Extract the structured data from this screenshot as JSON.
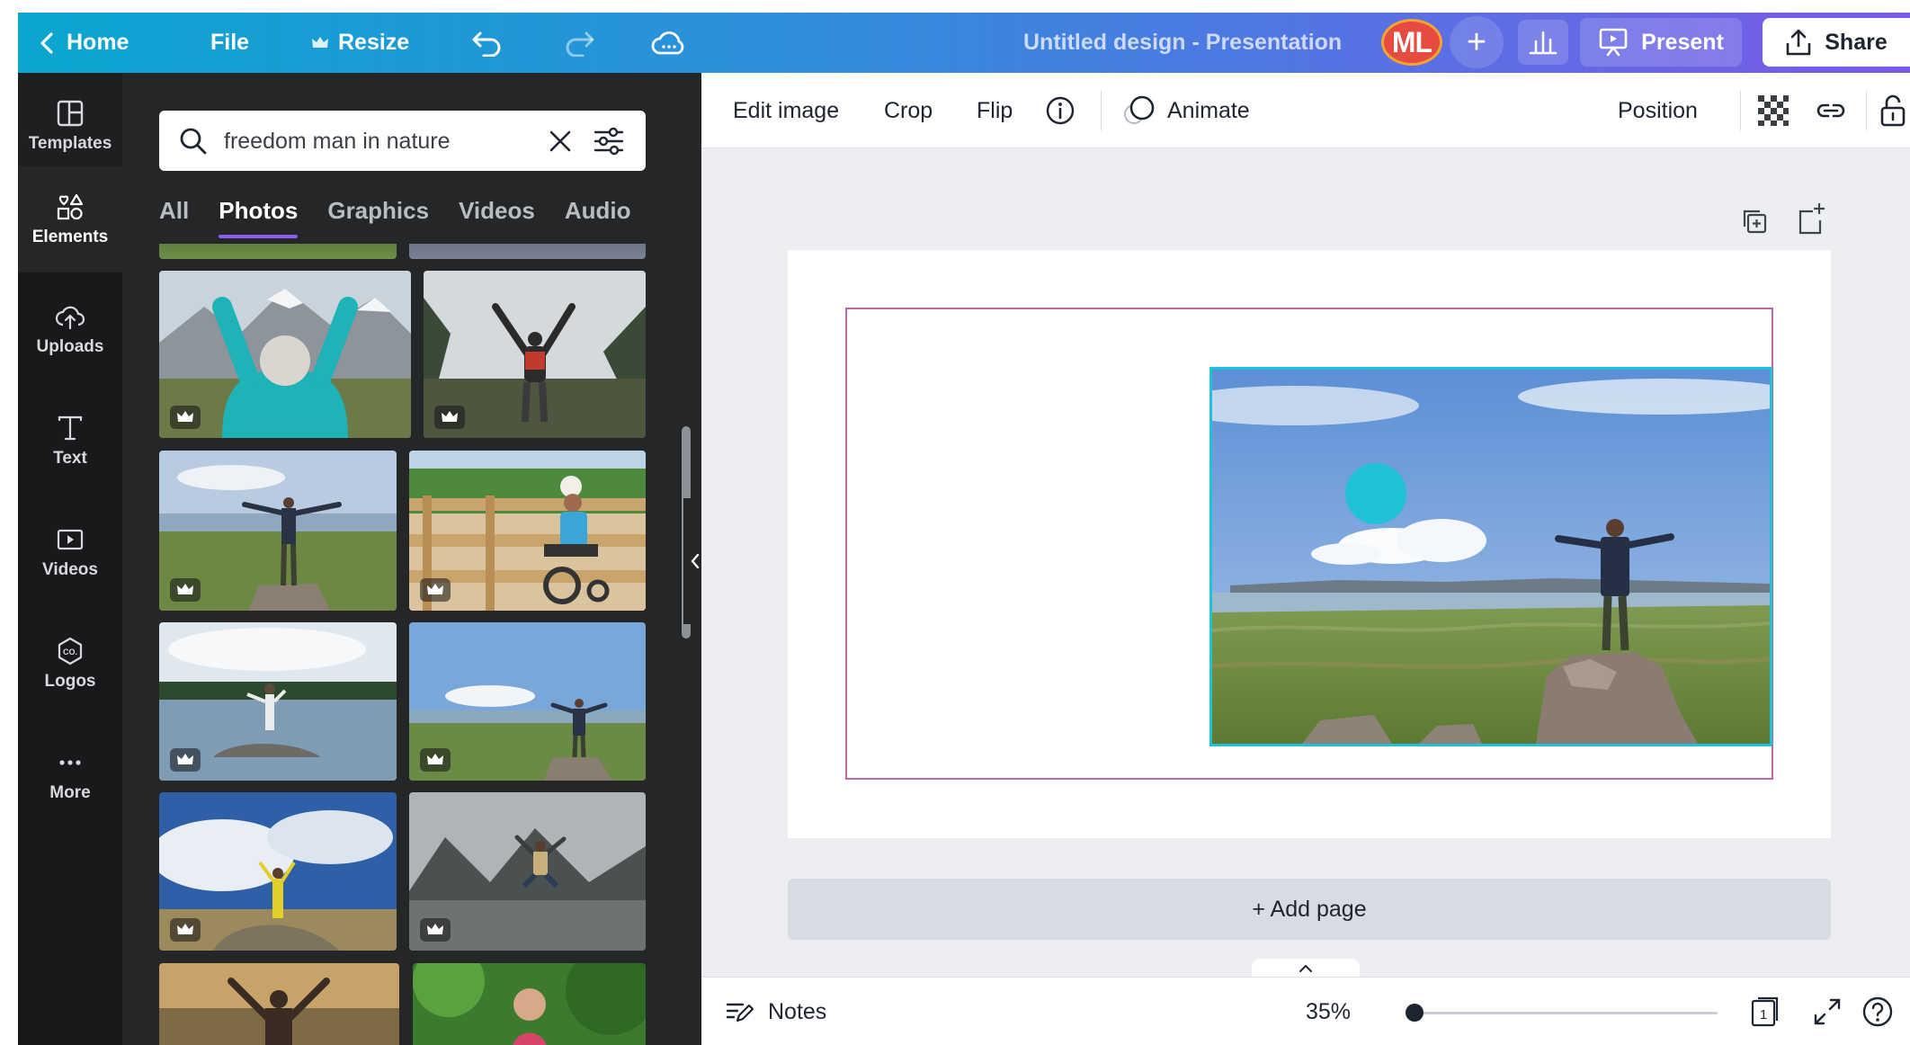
{
  "topbar": {
    "back_icon": "chevron-left-icon",
    "home_label": "Home",
    "file_label": "File",
    "resize_icon": "crown-icon",
    "resize_label": "Resize",
    "undo_icon": "undo-icon",
    "redo_icon": "redo-icon",
    "cloud_icon": "cloud-sync-icon",
    "title": "Untitled design - Presentation",
    "avatar_initials": "ML",
    "add_collaborator": "+",
    "present_label": "Present",
    "share_label": "Share"
  },
  "rail": {
    "items": [
      {
        "label": "Templates",
        "icon": "templates-icon"
      },
      {
        "label": "Elements",
        "icon": "elements-icon"
      },
      {
        "label": "Uploads",
        "icon": "cloud-upload-icon"
      },
      {
        "label": "Text",
        "icon": "text-icon"
      },
      {
        "label": "Videos",
        "icon": "video-icon"
      },
      {
        "label": "Logos",
        "icon": "logos-icon"
      },
      {
        "label": "More",
        "icon": "more-dots-icon"
      }
    ],
    "active": "Elements"
  },
  "panel": {
    "search_value": "freedom man in nature",
    "tabs": [
      "All",
      "Photos",
      "Graphics",
      "Videos",
      "Audio"
    ],
    "active_tab": "Photos"
  },
  "toolbar": {
    "edit_image": "Edit image",
    "crop": "Crop",
    "flip": "Flip",
    "animate": "Animate",
    "position": "Position"
  },
  "canvas": {
    "add_page": "+ Add page"
  },
  "footer": {
    "notes": "Notes",
    "zoom": "35%",
    "zoom_fraction": 0.02,
    "page_number": "1"
  },
  "colors": {
    "selection": "#1fc2d6",
    "page_border": "#b86aa6",
    "tab_underline": "#8b5cf6",
    "avatar": "#e54b3f"
  }
}
